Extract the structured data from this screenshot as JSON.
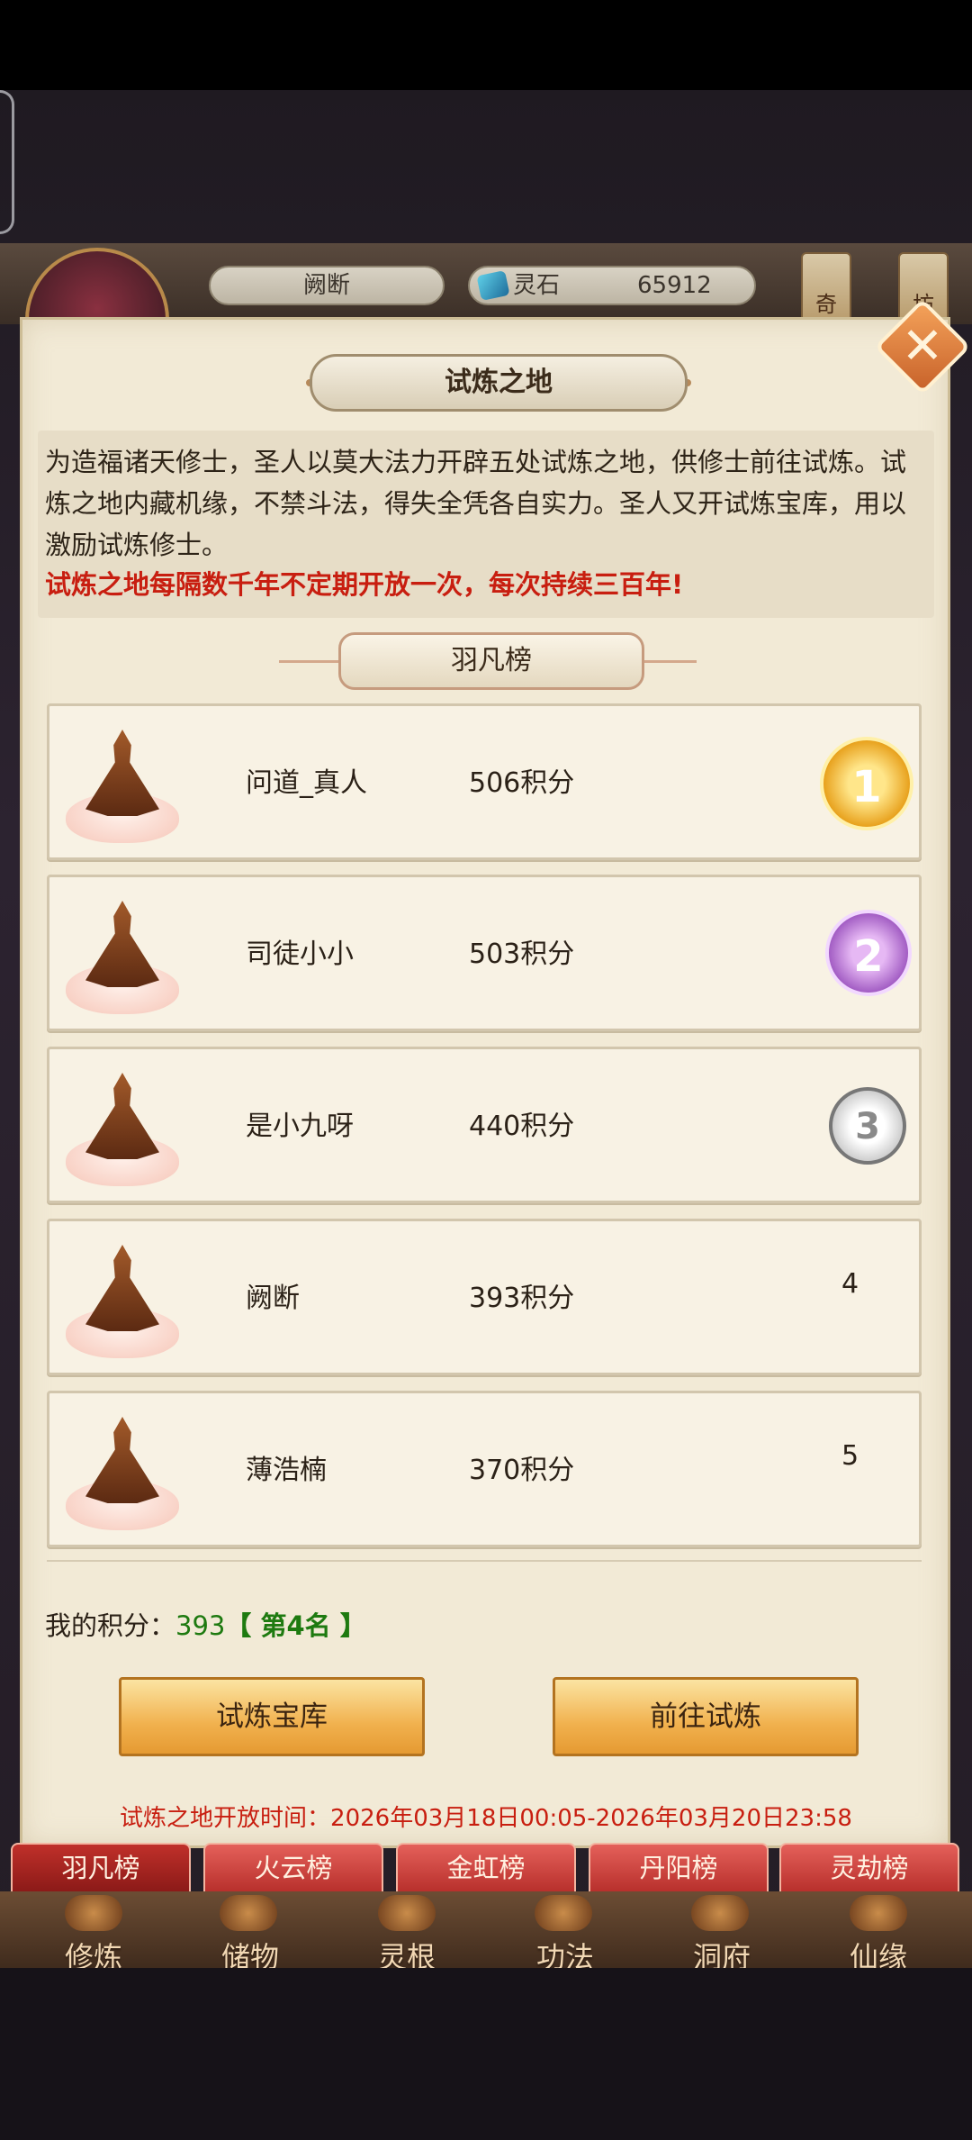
{
  "header": {
    "player_name": "阙断",
    "resource_label": "灵石",
    "resource_value": "65912",
    "side_buttons": [
      "奇",
      "坊"
    ]
  },
  "panel": {
    "title": "试炼之地",
    "description": "为造福诸天修士，圣人以莫大法力开辟五处试炼之地，供修士前往试炼。试炼之地内藏机缘，不禁斗法，得失全凭各自实力。圣人又开试炼宝库，用以激励试炼修士。",
    "notice": "试炼之地每隔数千年不定期开放一次，每次持续三百年!",
    "section_title": "羽凡榜"
  },
  "rankings": [
    {
      "name": "问道_真人",
      "score": "506积分",
      "rank": "1"
    },
    {
      "name": "司徒小小",
      "score": "503积分",
      "rank": "2"
    },
    {
      "name": "是小九呀",
      "score": "440积分",
      "rank": "3"
    },
    {
      "name": "阙断",
      "score": "393积分",
      "rank": "4"
    },
    {
      "name": "薄浩楠",
      "score": "370积分",
      "rank": "5"
    }
  ],
  "my_score": {
    "label": "我的积分：",
    "value": "393",
    "rank": "【 第4名 】"
  },
  "buttons": {
    "treasury": "试炼宝库",
    "go_trial": "前往试炼"
  },
  "open_time": "试炼之地开放时间：2026年03月18日00:05-2026年03月20日23:58",
  "tabs": [
    "羽凡榜",
    "火云榜",
    "金虹榜",
    "丹阳榜",
    "灵劫榜"
  ],
  "nav": [
    "修炼",
    "储物",
    "灵根",
    "功法",
    "洞府",
    "仙缘"
  ],
  "colors": {
    "notice_red": "#c81e10",
    "score_green": "#1e7a10",
    "tab_red": "#b8302c",
    "button_gold": "#f1b14e"
  }
}
